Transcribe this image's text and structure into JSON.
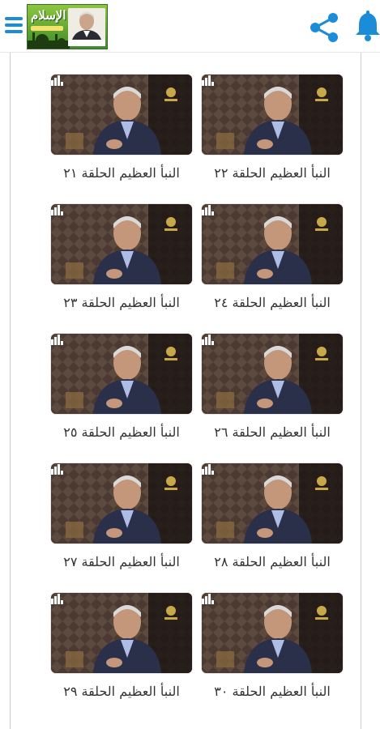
{
  "topbar": {
    "logo_text": "الإسلام",
    "menu_icon": "hamburger-menu-icon",
    "share_icon": "share-icon",
    "bell_icon": "bell-icon",
    "accent_color": "#1a8cd8"
  },
  "episodes": [
    {
      "title": "النبأ العظيم الحلقة ٢٢"
    },
    {
      "title": "النبأ العظيم الحلقة ٢١"
    },
    {
      "title": "النبأ العظيم الحلقة ٢٤"
    },
    {
      "title": "النبأ العظيم الحلقة ٢٣"
    },
    {
      "title": "النبأ العظيم الحلقة ٢٦"
    },
    {
      "title": "النبأ العظيم الحلقة ٢٥"
    },
    {
      "title": "النبأ العظيم الحلقة ٢٨"
    },
    {
      "title": "النبأ العظيم الحلقة ٢٧"
    },
    {
      "title": "النبأ العظيم الحلقة ٣٠"
    },
    {
      "title": "النبأ العظيم الحلقة ٢٩"
    }
  ]
}
